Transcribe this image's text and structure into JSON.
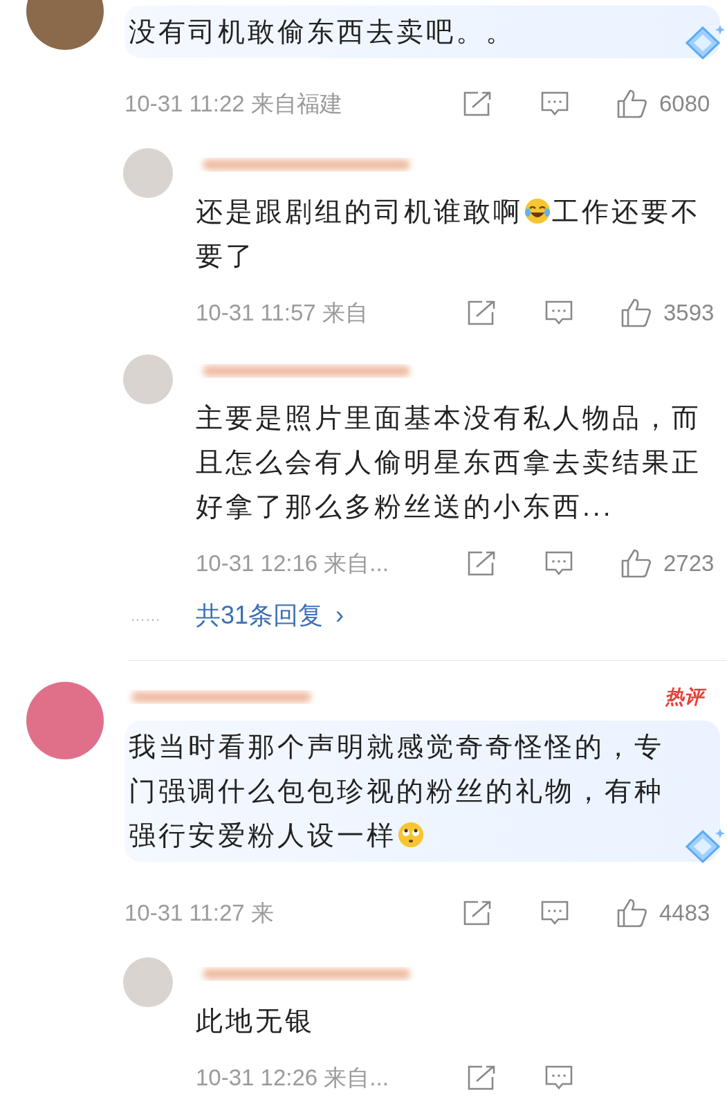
{
  "comments": [
    {
      "kind": "top",
      "bubble": true,
      "segments": [
        {
          "kind": "text",
          "text": "没有司机敢偷东西去卖吧。。"
        }
      ],
      "time": "10-31 11:22 来自福建",
      "likes": "6080",
      "replies": [
        {
          "segments": [
            {
              "kind": "text",
              "text": "还是跟剧组的司机谁敢啊"
            },
            {
              "kind": "laughing_face"
            },
            {
              "kind": "text",
              "text": "工作还要不要了"
            }
          ],
          "time": "10-31 11:57 来自",
          "likes": "3593"
        },
        {
          "segments": [
            {
              "kind": "text",
              "text": "主要是照片里面基本没有私人物品，而且怎么会有人偷明星东西拿去卖结果正好拿了那么多粉丝送的小东西..."
            }
          ],
          "time": "10-31 12:16 来自...",
          "likes": "2723"
        }
      ],
      "more": {
        "dots": "……",
        "label": "共31条回复",
        "arrow": "›"
      }
    },
    {
      "kind": "main",
      "badge": "热评",
      "bubble": true,
      "segments": [
        {
          "kind": "text",
          "text": "我当时看那个声明就感觉奇奇怪怪的，专门强调什么包包珍视的粉丝的礼物，有种强行安爱粉人设一样"
        },
        {
          "kind": "eye_roll_face"
        }
      ],
      "time": "10-31 11:27 来",
      "likes": "4483",
      "replies": [
        {
          "segments": [
            {
              "kind": "text",
              "text": "此地无银"
            }
          ],
          "time": "10-31 12:26 来自..."
        }
      ]
    }
  ]
}
